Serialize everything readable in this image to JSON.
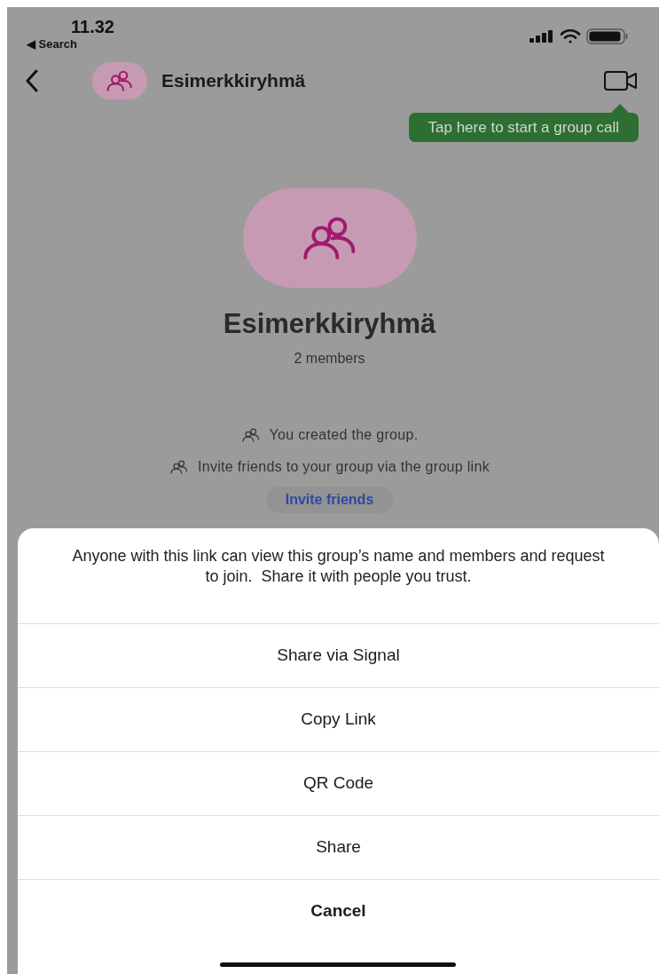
{
  "status_bar": {
    "time": "11.32",
    "back_label": "◀ Search"
  },
  "header": {
    "title": "Esimerkkiryhmä"
  },
  "tooltip": {
    "text": "Tap here to start a group call"
  },
  "group": {
    "name": "Esimerkkiryhmä",
    "members": "2 members"
  },
  "events": [
    {
      "text": "You created the group."
    },
    {
      "text": "Invite friends to your group via the group link"
    }
  ],
  "invite_button": "Invite friends",
  "sheet": {
    "message": "Anyone with this link can view this group’s name and members and request to join.  Share it with people you trust.",
    "actions": [
      {
        "label": "Share via Signal",
        "kind": "default"
      },
      {
        "label": "Copy Link",
        "kind": "default"
      },
      {
        "label": "QR Code",
        "kind": "default"
      },
      {
        "label": "Share",
        "kind": "default"
      },
      {
        "label": "Cancel",
        "kind": "cancel"
      }
    ]
  }
}
